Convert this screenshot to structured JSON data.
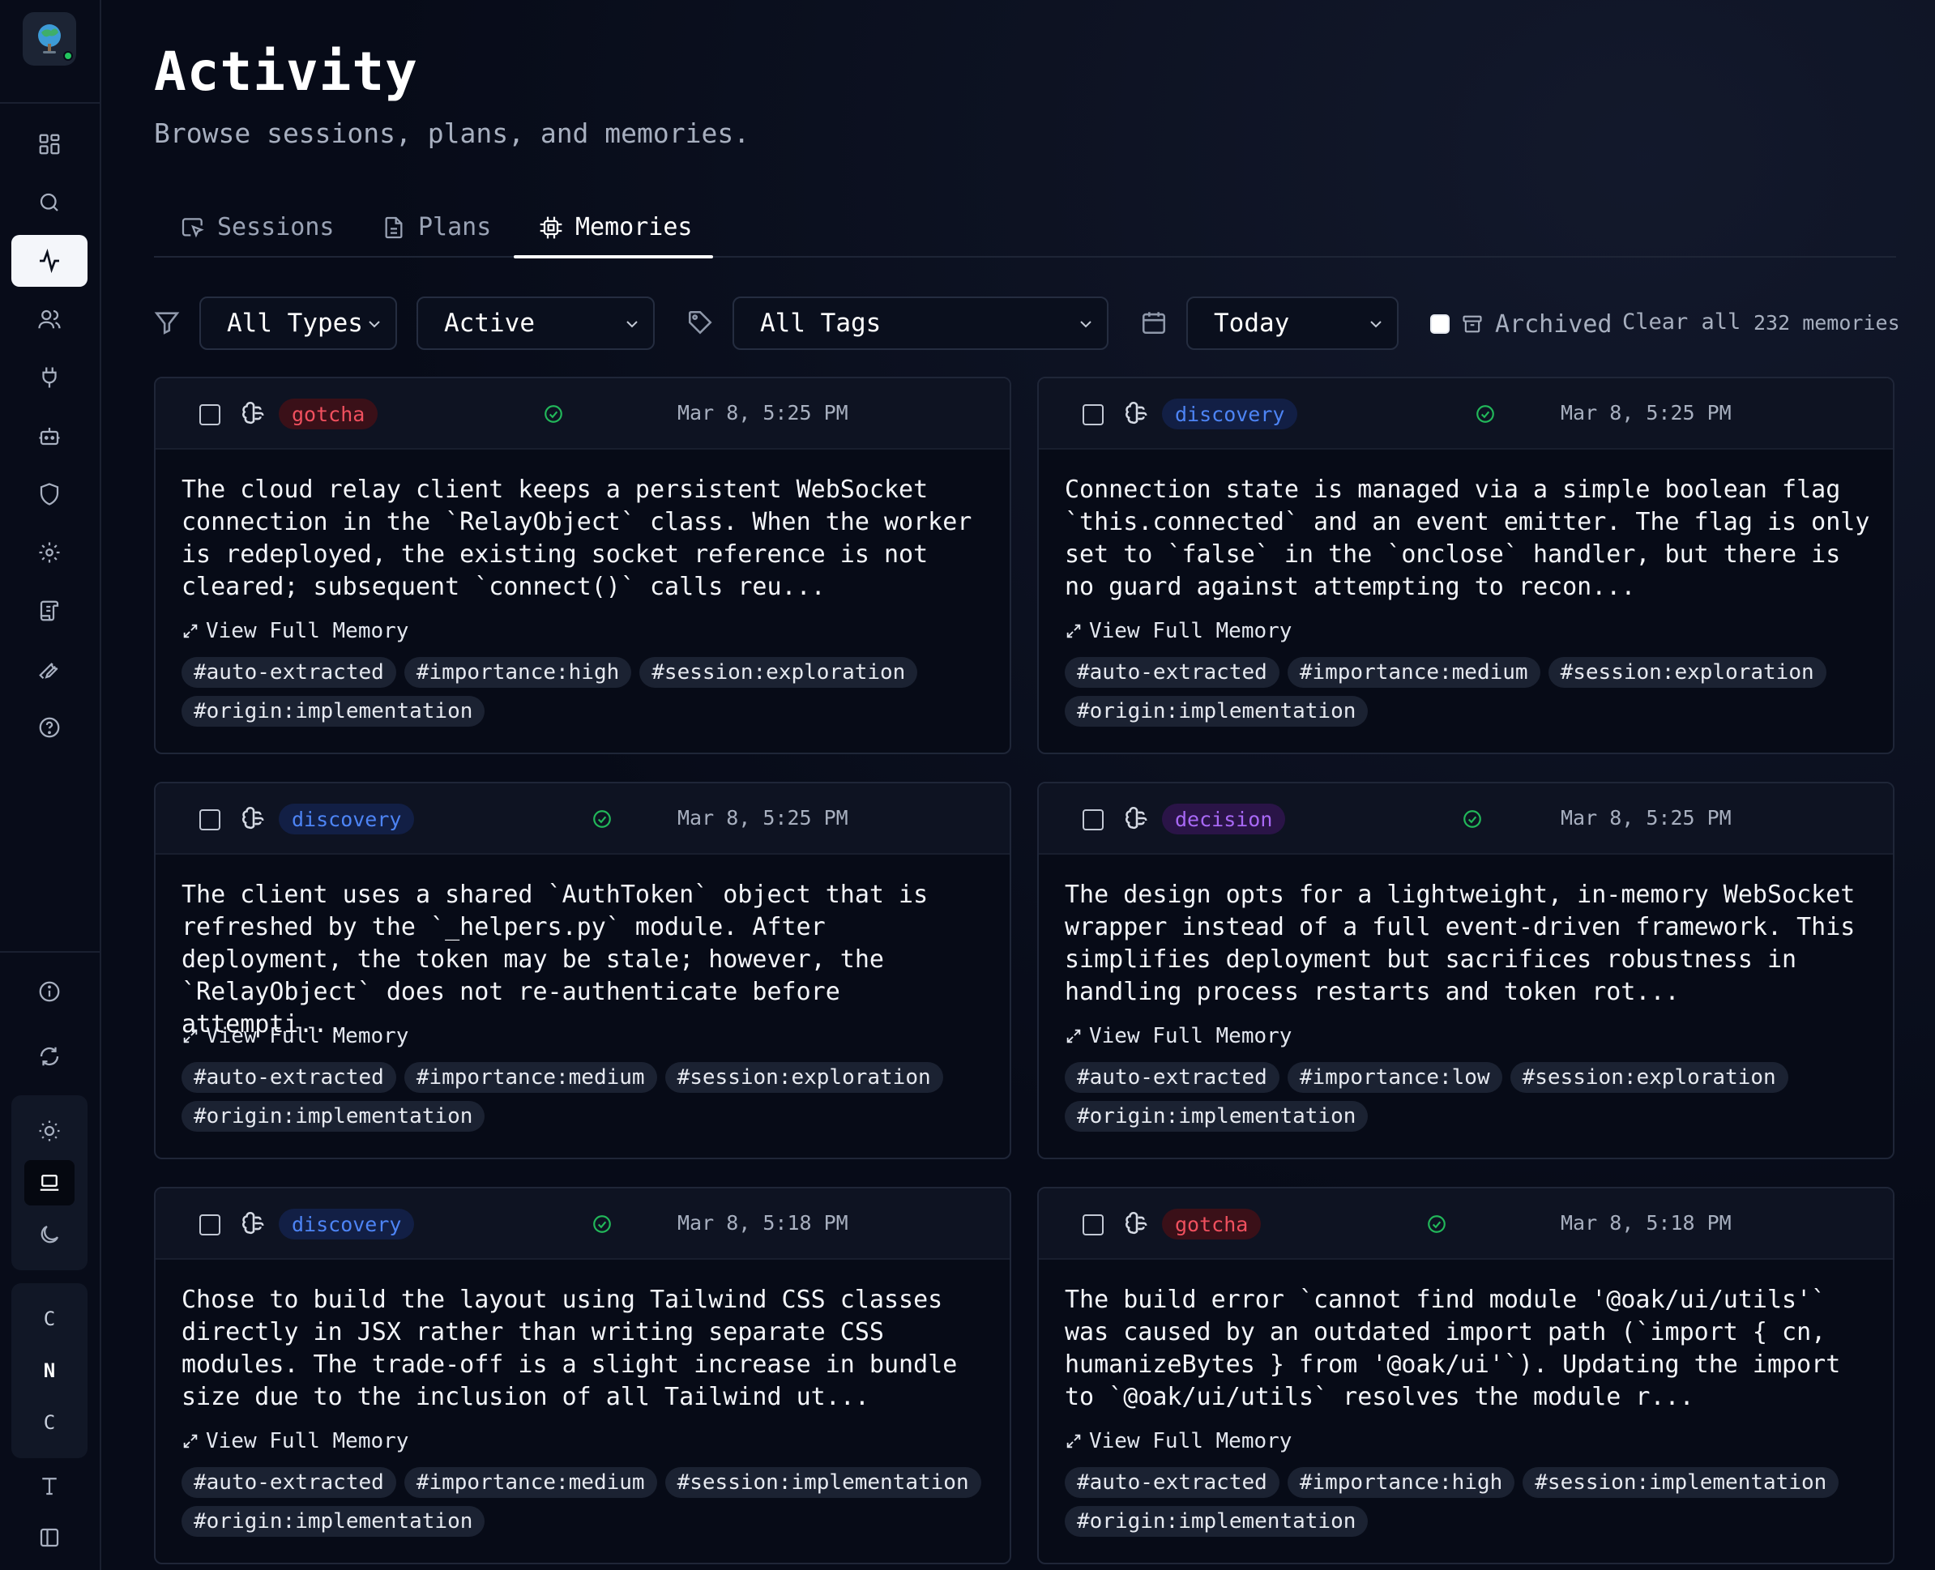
{
  "page": {
    "title": "Activity",
    "subtitle": "Browse sessions, plans, and memories."
  },
  "tabs": [
    {
      "label": "Sessions",
      "icon": "cursor-window-icon"
    },
    {
      "label": "Plans",
      "icon": "document-icon"
    },
    {
      "label": "Memories",
      "icon": "chip-icon",
      "active": true
    }
  ],
  "filters": {
    "type": "All Types",
    "status": "Active",
    "tags": "All Tags",
    "date": "Today",
    "archived_label": "Archived",
    "clear_label": "Clear all",
    "count_label": "232 memories"
  },
  "sidebar": {
    "letters": [
      "C",
      "N",
      "C"
    ],
    "active_item": "activity"
  },
  "colors": {
    "gotcha": "#f0505e",
    "discovery": "#4d84f5",
    "decision": "#a868f5",
    "success": "#22b85a"
  },
  "cards": [
    {
      "type": "gotcha",
      "date": "Mar 8, 5:25 PM",
      "body": "The cloud relay client keeps a persistent WebSocket connection in the `RelayObject` class. When the worker is redeployed, the existing socket reference is not cleared; subsequent `connect()` calls reu...",
      "link": "View Full Memory",
      "tags": [
        "#auto-extracted",
        "#importance:high",
        "#session:exploration",
        "#origin:implementation"
      ]
    },
    {
      "type": "discovery",
      "date": "Mar 8, 5:25 PM",
      "body": "Connection state is managed via a simple boolean flag `this.connected` and an event emitter. The flag is only set to `false` in the `onclose` handler, but there is no guard against attempting to recon...",
      "link": "View Full Memory",
      "tags": [
        "#auto-extracted",
        "#importance:medium",
        "#session:exploration",
        "#origin:implementation"
      ]
    },
    {
      "type": "discovery",
      "date": "Mar 8, 5:25 PM",
      "body": "The client uses a shared `AuthToken` object that is refreshed by the `_helpers.py` module. After deployment, the token may be stale; however, the `RelayObject` does not re-authenticate before attempti...",
      "link": "View Full Memory",
      "tags": [
        "#auto-extracted",
        "#importance:medium",
        "#session:exploration",
        "#origin:implementation"
      ]
    },
    {
      "type": "decision",
      "date": "Mar 8, 5:25 PM",
      "body": "The design opts for a lightweight, in-memory WebSocket wrapper instead of a full event-driven framework. This simplifies deployment but sacrifices robustness in handling process restarts and token rot...",
      "link": "View Full Memory",
      "tags": [
        "#auto-extracted",
        "#importance:low",
        "#session:exploration",
        "#origin:implementation"
      ]
    },
    {
      "type": "discovery",
      "date": "Mar 8, 5:18 PM",
      "body": "Chose to build the layout using Tailwind CSS classes directly in JSX rather than writing separate CSS modules. The trade-off is a slight increase in bundle size due to the inclusion of all Tailwind ut...",
      "link": "View Full Memory",
      "tags": [
        "#auto-extracted",
        "#importance:medium",
        "#session:implementation",
        "#origin:implementation"
      ]
    },
    {
      "type": "gotcha",
      "date": "Mar 8, 5:18 PM",
      "body": "The build error `cannot find module '@oak/ui/utils'` was caused by an outdated import path (`import { cn, humanizeBytes } from '@oak/ui'`). Updating the import to `@oak/ui/utils` resolves the module r...",
      "link": "View Full Memory",
      "tags": [
        "#auto-extracted",
        "#importance:high",
        "#session:implementation",
        "#origin:implementation"
      ]
    }
  ]
}
